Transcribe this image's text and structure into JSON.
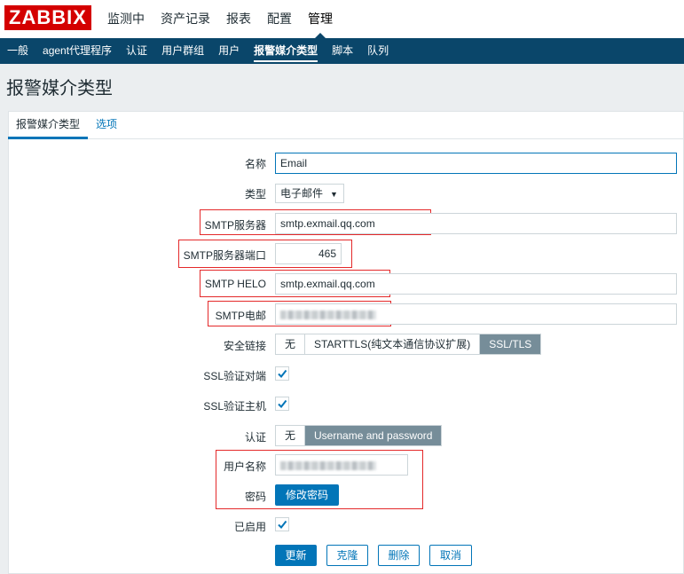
{
  "app": {
    "logo": "ZABBIX"
  },
  "topnav": [
    "监测中",
    "资产记录",
    "报表",
    "配置",
    "管理"
  ],
  "subnav": [
    "一般",
    "agent代理程序",
    "认证",
    "用户群组",
    "用户",
    "报警媒介类型",
    "脚本",
    "队列"
  ],
  "page_title": "报警媒介类型",
  "tabs": [
    "报警媒介类型",
    "选项"
  ],
  "form": {
    "name": {
      "label": "名称",
      "value": "Email"
    },
    "type": {
      "label": "类型",
      "value": "电子邮件"
    },
    "smtp_server": {
      "label": "SMTP服务器",
      "value": "smtp.exmail.qq.com"
    },
    "smtp_port": {
      "label": "SMTP服务器端口",
      "value": "465"
    },
    "smtp_helo": {
      "label": "SMTP HELO",
      "value": "smtp.exmail.qq.com"
    },
    "smtp_email": {
      "label": "SMTP电邮"
    },
    "security": {
      "label": "安全链接",
      "options": [
        "无",
        "STARTTLS(纯文本通信协议扩展)",
        "SSL/TLS"
      ],
      "selected": "SSL/TLS"
    },
    "ssl_verify_peer": {
      "label": "SSL验证对端",
      "checked": true
    },
    "ssl_verify_host": {
      "label": "SSL验证主机",
      "checked": true
    },
    "auth": {
      "label": "认证",
      "options": [
        "无",
        "Username and password"
      ],
      "selected": "Username and password"
    },
    "username": {
      "label": "用户名称"
    },
    "password": {
      "label": "密码",
      "button": "修改密码"
    },
    "enabled": {
      "label": "已启用",
      "checked": true
    }
  },
  "actions": {
    "update": "更新",
    "clone": "克隆",
    "delete": "删除",
    "cancel": "取消"
  },
  "colors": {
    "accent": "#0275b8",
    "nav": "#0a466a",
    "brand": "#d40000",
    "highlight": "#e4292a"
  }
}
